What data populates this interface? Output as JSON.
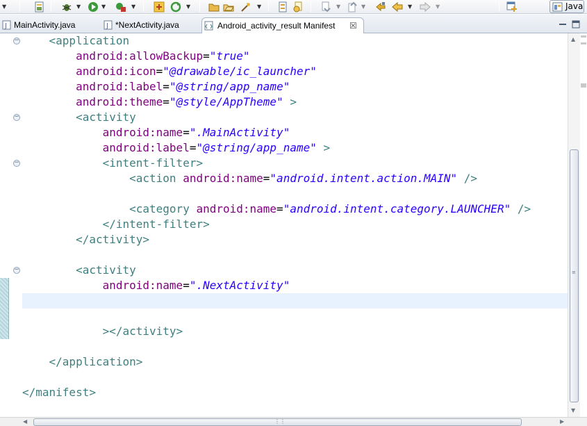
{
  "toolbar": {
    "perspective_label": "Java",
    "icons": [
      "dropdown-arrow-icon",
      "new-file-icon",
      "debug-icon",
      "run-icon",
      "external-tools-icon",
      "new-java-class-icon",
      "refresh-icon",
      "open-folder-icon",
      "open-type-icon",
      "search-icon",
      "toggle-mark-icon",
      "annotation-icon",
      "next-annotation-icon",
      "prev-annotation-icon",
      "back-icon",
      "forward-icon",
      "open-perspective-icon"
    ]
  },
  "tabs": [
    {
      "label": "MainActivity.java",
      "active": false
    },
    {
      "label": "*NextActivity.java",
      "active": false
    },
    {
      "label": "Android_activity_result Manifest",
      "active": true,
      "close": "☒"
    }
  ],
  "editor": {
    "lines": [
      {
        "indent": "    ",
        "parts": [
          [
            "tag",
            "<application"
          ]
        ]
      },
      {
        "indent": "        ",
        "parts": [
          [
            "attr",
            "android:allowBackup"
          ],
          [
            "eq",
            "="
          ],
          [
            "val",
            "\"true\""
          ]
        ]
      },
      {
        "indent": "        ",
        "parts": [
          [
            "attr",
            "android:icon"
          ],
          [
            "eq",
            "="
          ],
          [
            "val",
            "\"@drawable/ic_launcher\""
          ]
        ]
      },
      {
        "indent": "        ",
        "parts": [
          [
            "attr",
            "android:label"
          ],
          [
            "eq",
            "="
          ],
          [
            "val",
            "\"@string/app_name\""
          ]
        ]
      },
      {
        "indent": "        ",
        "parts": [
          [
            "attr",
            "android:theme"
          ],
          [
            "eq",
            "="
          ],
          [
            "val",
            "\"@style/AppTheme\""
          ],
          [
            "tag",
            " >"
          ]
        ]
      },
      {
        "indent": "        ",
        "parts": [
          [
            "tag",
            "<activity"
          ]
        ]
      },
      {
        "indent": "            ",
        "parts": [
          [
            "attr",
            "android:name"
          ],
          [
            "eq",
            "="
          ],
          [
            "val",
            "\".MainActivity\""
          ]
        ]
      },
      {
        "indent": "            ",
        "parts": [
          [
            "attr",
            "android:label"
          ],
          [
            "eq",
            "="
          ],
          [
            "val",
            "\"@string/app_name\""
          ],
          [
            "tag",
            " >"
          ]
        ]
      },
      {
        "indent": "            ",
        "parts": [
          [
            "tag",
            "<intent-filter>"
          ]
        ]
      },
      {
        "indent": "                ",
        "parts": [
          [
            "tag",
            "<action "
          ],
          [
            "attr",
            "android:name"
          ],
          [
            "eq",
            "="
          ],
          [
            "val",
            "\"android.intent.action.MAIN\""
          ],
          [
            "tag",
            " />"
          ]
        ]
      },
      {
        "indent": "",
        "parts": []
      },
      {
        "indent": "                ",
        "parts": [
          [
            "tag",
            "<category "
          ],
          [
            "attr",
            "android:name"
          ],
          [
            "eq",
            "="
          ],
          [
            "val",
            "\"android.intent.category.LAUNCHER\""
          ],
          [
            "tag",
            " />"
          ]
        ]
      },
      {
        "indent": "            ",
        "parts": [
          [
            "tag",
            "</intent-filter>"
          ]
        ]
      },
      {
        "indent": "        ",
        "parts": [
          [
            "tag",
            "</activity>"
          ]
        ]
      },
      {
        "indent": "",
        "parts": []
      },
      {
        "indent": "        ",
        "parts": [
          [
            "tag",
            "<activity"
          ]
        ]
      },
      {
        "indent": "            ",
        "parts": [
          [
            "attr",
            "android:name"
          ],
          [
            "eq",
            "="
          ],
          [
            "val",
            "\".NextActivity\""
          ]
        ]
      },
      {
        "indent": "",
        "parts": []
      },
      {
        "indent": "",
        "parts": []
      },
      {
        "indent": "            ",
        "parts": [
          [
            "tag",
            "></activity>"
          ]
        ]
      },
      {
        "indent": "",
        "parts": []
      },
      {
        "indent": "    ",
        "parts": [
          [
            "tag",
            "</application>"
          ]
        ]
      },
      {
        "indent": "",
        "parts": []
      },
      {
        "indent": "",
        "parts": [
          [
            "tag",
            "</manifest>"
          ]
        ]
      }
    ],
    "current_line": 17,
    "fold_lines": [
      1,
      6,
      9,
      16
    ],
    "colors": {
      "tag": "#3f7f7f",
      "attr": "#7f007f",
      "value": "#2a00ff",
      "current_line_bg": "#e8f2fe"
    }
  }
}
